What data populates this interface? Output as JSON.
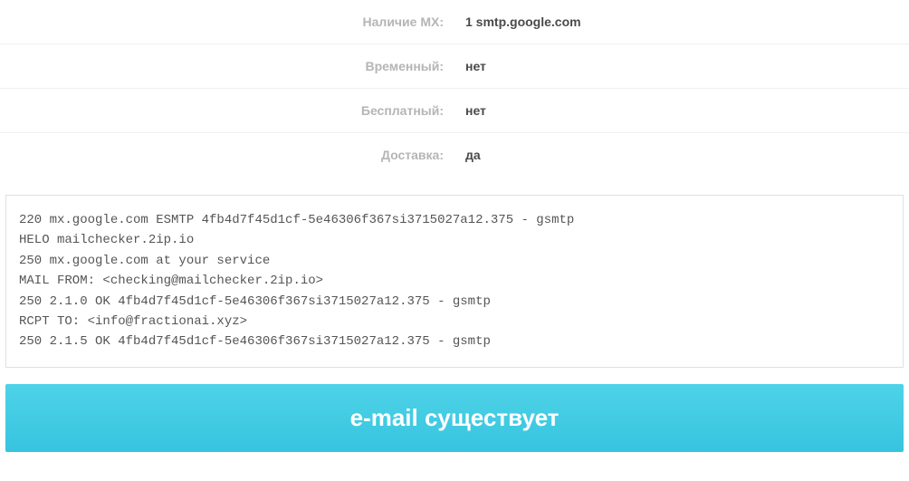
{
  "rows": [
    {
      "label": "Наличие MX:",
      "value": "1 smtp.google.com"
    },
    {
      "label": "Временный:",
      "value": "нет"
    },
    {
      "label": "Бесплатный:",
      "value": "нет"
    },
    {
      "label": "Доставка:",
      "value": "да"
    }
  ],
  "smtp_log": "220 mx.google.com ESMTP 4fb4d7f45d1cf-5e46306f367si3715027a12.375 - gsmtp\nHELO mailchecker.2ip.io\n250 mx.google.com at your service\nMAIL FROM: <checking@mailchecker.2ip.io>\n250 2.1.0 OK 4fb4d7f45d1cf-5e46306f367si3715027a12.375 - gsmtp\nRCPT TO: <info@fractionai.xyz>\n250 2.1.5 OK 4fb4d7f45d1cf-5e46306f367si3715027a12.375 - gsmtp",
  "result_text": "e-mail существует"
}
